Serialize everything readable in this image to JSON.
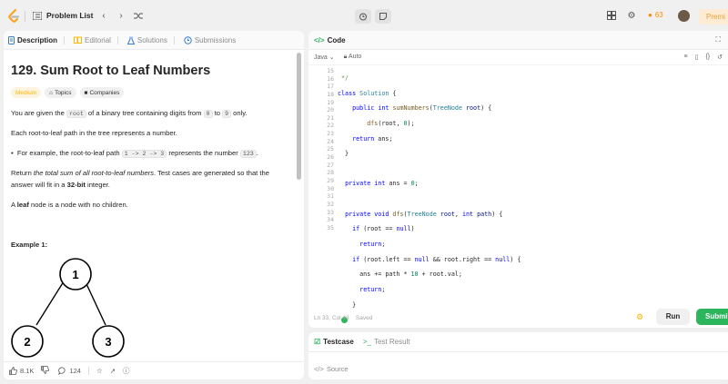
{
  "nav": {
    "problem_list": "Problem List",
    "streak": "63",
    "premium": "Premi"
  },
  "desc_tabs": [
    "Description",
    "Editorial",
    "Solutions",
    "Submissions"
  ],
  "problem": {
    "title": "129. Sum Root to Leaf Numbers",
    "tags": [
      "Medium",
      "Topics",
      "Companies"
    ],
    "p1_a": "You are given the ",
    "p1_code1": "root",
    "p1_b": " of a binary tree containing digits from ",
    "p1_code2": "0",
    "p1_c": " to ",
    "p1_code3": "9",
    "p1_d": " only.",
    "p2": "Each root-to-leaf path in the tree represents a number.",
    "p3_a": "For example, the root-to-leaf path ",
    "p3_code1": "1 -> 2 -> 3",
    "p3_b": " represents the number ",
    "p3_code2": "123",
    "p3_c": ".",
    "p4_a": "Return ",
    "p4_em": "the total sum of all root-to-leaf numbers",
    "p4_b": ". Test cases are generated so that the answer will fit in a ",
    "p4_strong": "32-bit",
    "p4_c": " integer.",
    "p5_a": "A ",
    "p5_strong": "leaf",
    "p5_b": " node is a node with no children.",
    "example_title": "Example 1:",
    "tree_nodes": [
      "1",
      "2",
      "3"
    ]
  },
  "footer": {
    "likes": "8.1K",
    "comments": "124"
  },
  "editor": {
    "header": "Code",
    "language": "Java",
    "auto": "Auto",
    "status_pos": "Ln 33, Col 43",
    "status_saved": "Saved",
    "run": "Run",
    "submit": "Submit"
  },
  "bottom_tabs": [
    "Testcase",
    "Test Result"
  ],
  "source": "Source"
}
